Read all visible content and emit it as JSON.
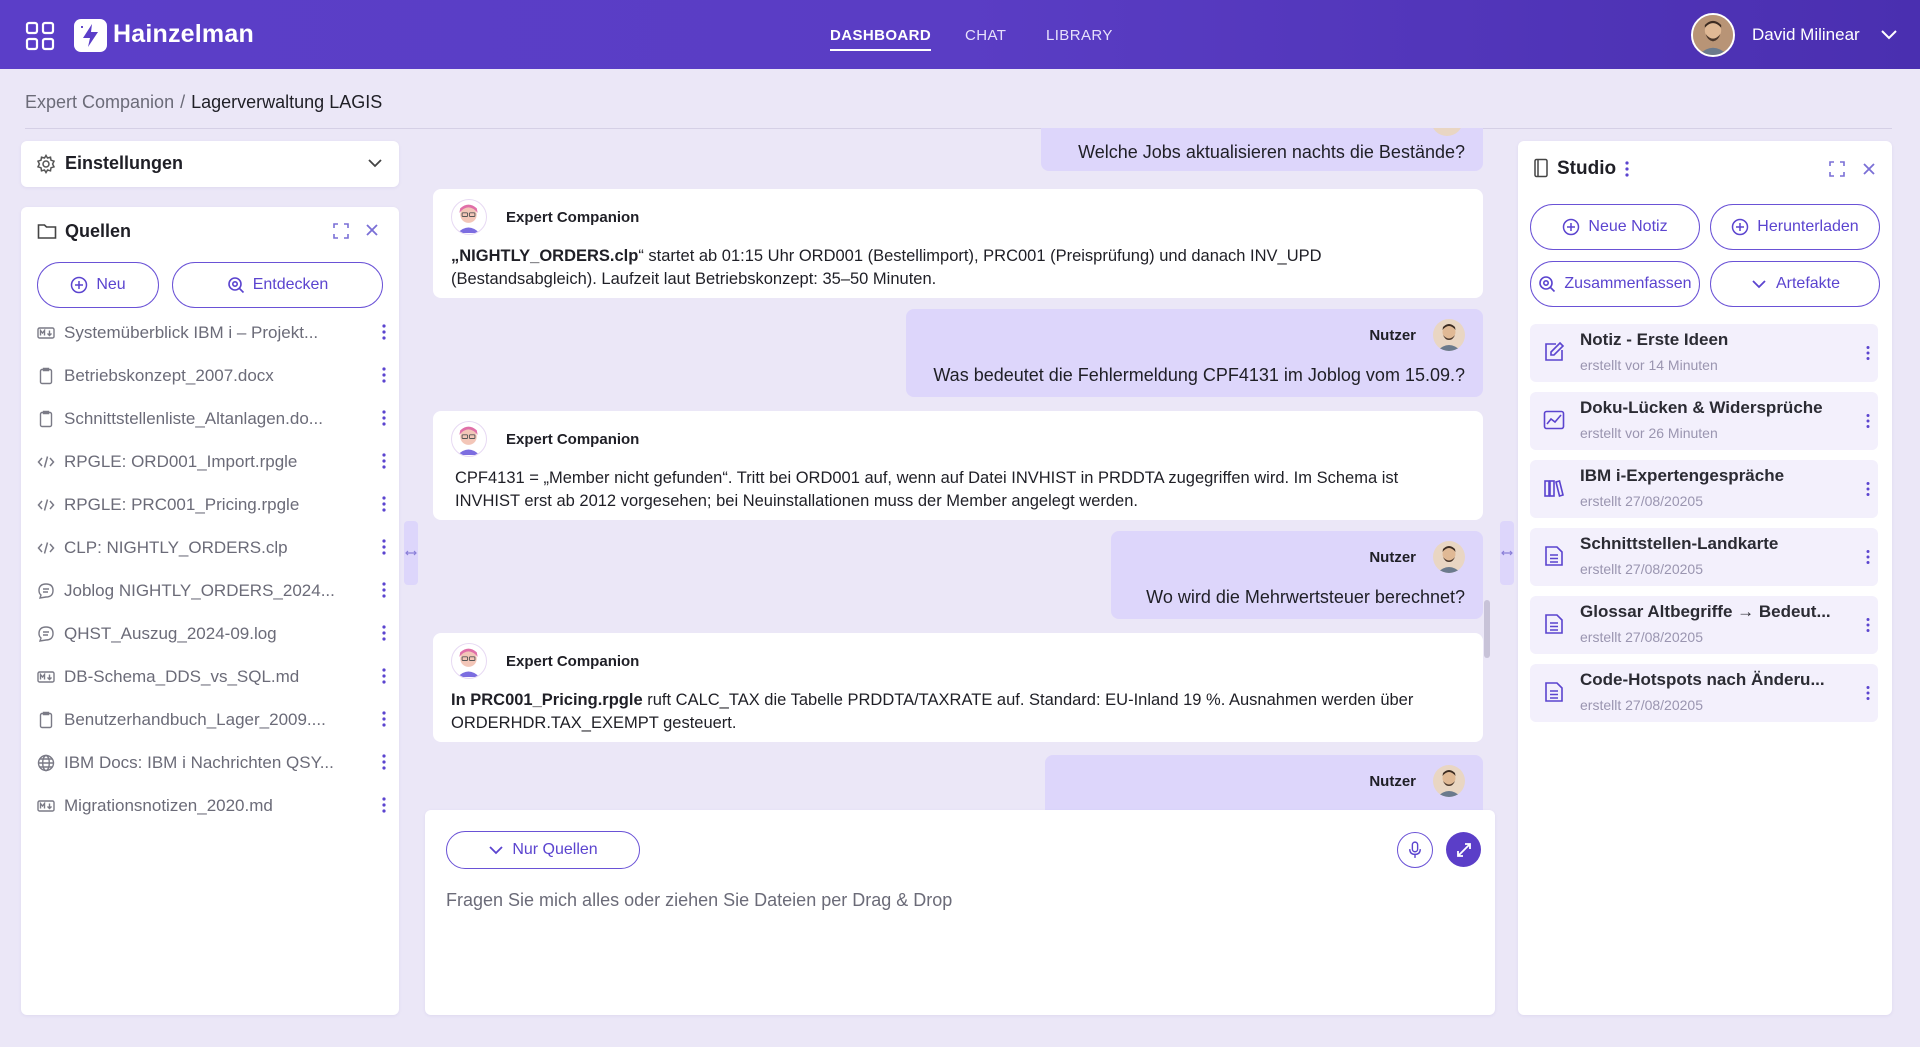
{
  "app": {
    "name": "Hainzelman",
    "nav": [
      "DASHBOARD",
      "CHAT",
      "LIBRARY"
    ],
    "active_nav": "DASHBOARD",
    "user_name": "David Milinear",
    "accent_color": "#5b3ec8"
  },
  "breadcrumb": {
    "parent": "Expert Companion",
    "separator": "/",
    "current": "Lagerverwaltung LAGIS"
  },
  "settings": {
    "title": "Einstellungen"
  },
  "sources": {
    "title": "Quellen",
    "new_label": "Neu",
    "discover_label": "Entdecken",
    "items": [
      {
        "icon": "markdown-icon",
        "label": "Systemüberblick IBM i – Projekt..."
      },
      {
        "icon": "document-icon",
        "label": "Betriebskonzept_2007.docx"
      },
      {
        "icon": "document-icon",
        "label": "Schnittstellenliste_Altanlagen.do..."
      },
      {
        "icon": "code-icon",
        "label": "RPGLE: ORD001_Import.rpgle"
      },
      {
        "icon": "code-icon",
        "label": "RPGLE: PRC001_Pricing.rpgle"
      },
      {
        "icon": "code-icon",
        "label": "CLP: NIGHTLY_ORDERS.clp"
      },
      {
        "icon": "chat-log-icon",
        "label": "Joblog NIGHTLY_ORDERS_2024..."
      },
      {
        "icon": "chat-log-icon",
        "label": "QHST_Auszug_2024-09.log"
      },
      {
        "icon": "markdown-icon",
        "label": "DB-Schema_DDS_vs_SQL.md"
      },
      {
        "icon": "document-icon",
        "label": "Benutzerhandbuch_Lager_2009...."
      },
      {
        "icon": "globe-icon",
        "label": "IBM Docs: IBM i Nachrichten QSY..."
      },
      {
        "icon": "markdown-icon",
        "label": "Migrationsnotizen_2020.md"
      }
    ]
  },
  "chat": {
    "user_label": "Nutzer",
    "bot_label": "Expert Companion",
    "messages": [
      {
        "role": "user",
        "text": "Welche Jobs aktualisieren nachts die Bestände?"
      },
      {
        "role": "bot",
        "bold": "„NIGHTLY_ORDERS.clp",
        "text": "“ startet ab 01:15 Uhr ORD001 (Bestellimport), PRC001 (Preisprüfung) und danach INV_UPD (Bestandsabgleich). Laufzeit laut Betriebskonzept: 35–50 Minuten."
      },
      {
        "role": "user",
        "text": "Was bedeutet die Fehlermeldung CPF4131 im Joblog vom 15.09.?"
      },
      {
        "role": "bot",
        "bold": "",
        "text": "CPF4131 = „Member nicht gefunden“. Tritt bei ORD001 auf, wenn auf Datei INVHIST in PRDDTA zugegriffen wird. Im Schema ist INVHIST erst ab 2012 vorgesehen; bei Neuinstallationen muss der Member angelegt werden."
      },
      {
        "role": "user",
        "text": "Wo wird die Mehrwertsteuer berechnet?"
      },
      {
        "role": "bot",
        "bold": "In PRC001_Pricing.rpgle",
        "text": " ruft CALC_TAX die Tabelle PRDDTA/TAXRATE auf. Standard: EU-Inland 19 %. Ausnahmen werden über ORDERHDR.TAX_EXEMPT gesteuert."
      },
      {
        "role": "user",
        "text": ""
      }
    ],
    "filter_label": "Nur Quellen",
    "input_placeholder": "Fragen Sie mich alles oder ziehen Sie Dateien per Drag & Drop"
  },
  "studio": {
    "title": "Studio",
    "buttons": {
      "new_note": "Neue Notiz",
      "download": "Herunterladen",
      "summarize": "Zusammenfassen",
      "artifacts": "Artefakte"
    },
    "artifacts": [
      {
        "icon": "edit-note-icon",
        "title": "Notiz - Erste Ideen",
        "subtitle": "erstellt vor 14 Minuten"
      },
      {
        "icon": "chart-icon",
        "title": "Doku-Lücken & Widersprüche",
        "subtitle": "erstellt vor 26 Minuten"
      },
      {
        "icon": "books-icon",
        "title": "IBM i-Expertengespräche",
        "subtitle": "erstellt 27/08/20205"
      },
      {
        "icon": "file-text-icon",
        "title": "Schnittstellen-Landkarte",
        "subtitle": "erstellt 27/08/20205"
      },
      {
        "icon": "file-text-icon",
        "title": "Glossar Altbegriffe → Bedeut...",
        "subtitle": "erstellt 27/08/20205"
      },
      {
        "icon": "file-text-icon",
        "title": "Code-Hotspots nach Änderu...",
        "subtitle": "erstellt 27/08/20205"
      }
    ]
  }
}
